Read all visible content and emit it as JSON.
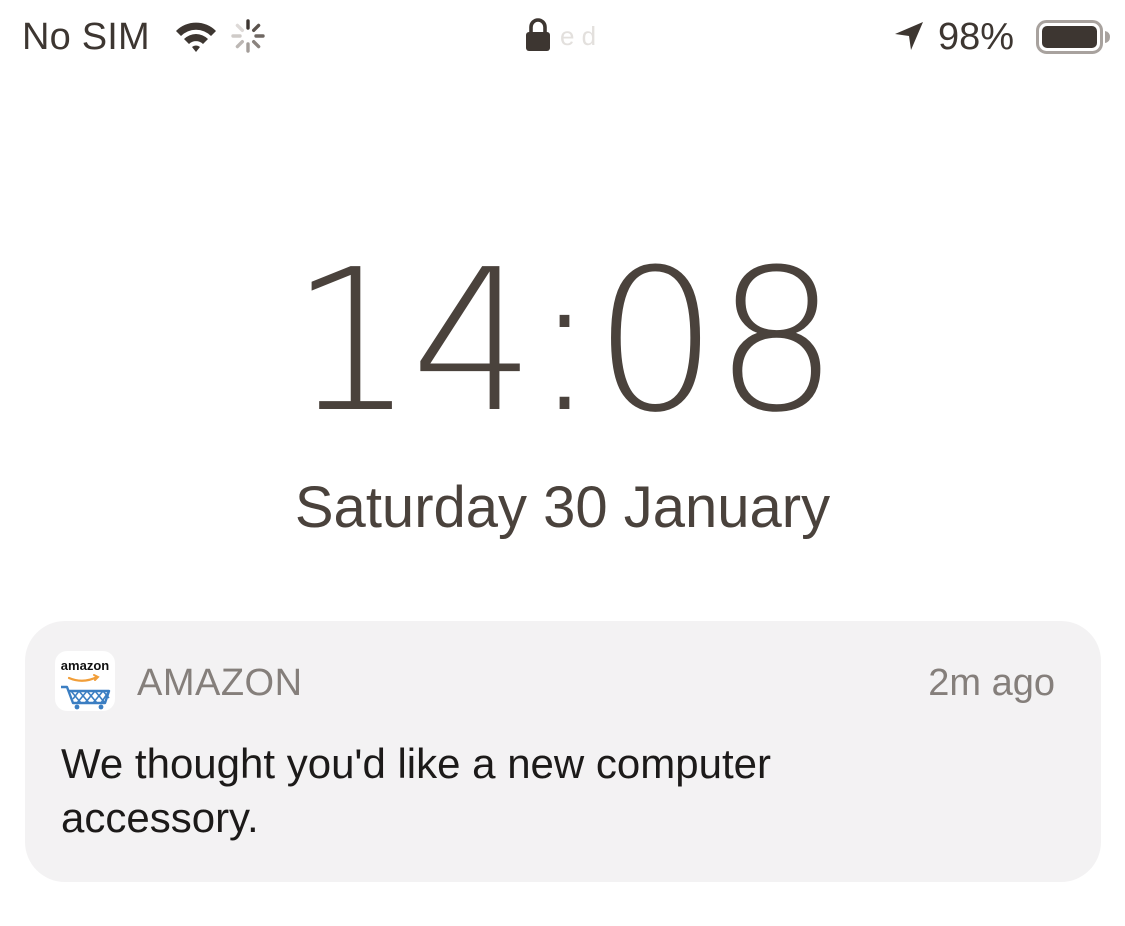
{
  "status_bar": {
    "carrier": "No SIM",
    "wifi_icon": "wifi-icon",
    "activity_icon": "activity-spinner-icon",
    "lock_icon": "lock-icon",
    "lock_trailing_text": "e d",
    "location_icon": "location-arrow-icon",
    "battery_percent": "98%",
    "battery_level": 0.98,
    "battery_icon": "battery-icon"
  },
  "lock_screen": {
    "time": "14:08",
    "date": "Saturday 30 January"
  },
  "notification": {
    "app_icon_label": "amazon",
    "app_icon": "amazon-cart-icon",
    "app_name": "AMAZON",
    "time_ago": "2m ago",
    "message": "We thought you'd like a new computer accessory."
  },
  "colors": {
    "text_primary": "#3d3631",
    "notification_background": "#f3f2f3",
    "secondary_text": "#857f7b",
    "amazon_orange": "#f19e39",
    "amazon_cart_blue": "#3b7ec2"
  }
}
